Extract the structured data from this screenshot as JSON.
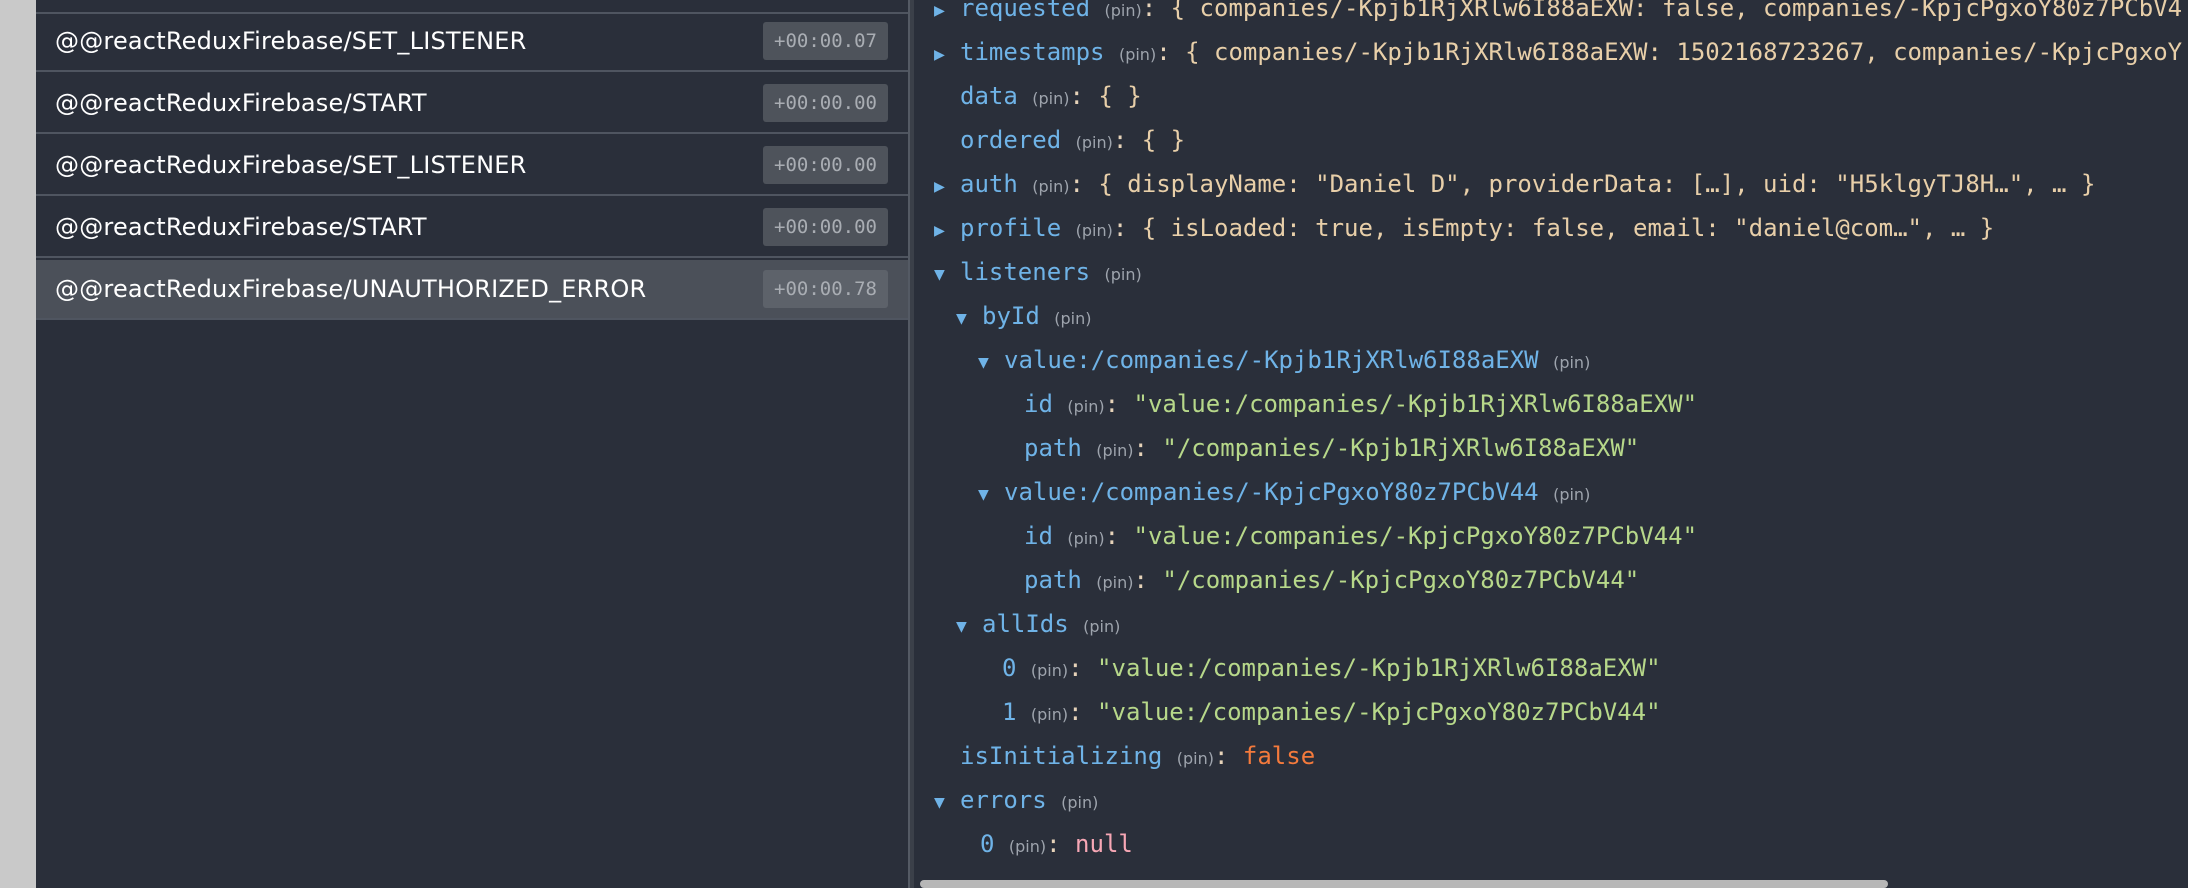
{
  "actions": [
    {
      "name": "@@reactReduxFirebase/SET_LISTENER",
      "time": "+00:00.07"
    },
    {
      "name": "@@reactReduxFirebase/START",
      "time": "+00:00.00"
    },
    {
      "name": "@@reactReduxFirebase/SET_LISTENER",
      "time": "+00:00.00"
    },
    {
      "name": "@@reactReduxFirebase/START",
      "time": "+00:00.00"
    },
    {
      "name": "@@reactReduxFirebase/UNAUTHORIZED_ERROR",
      "time": "+00:00.78",
      "selected": true
    }
  ],
  "tree": {
    "pin": "(pin)",
    "requested": {
      "key": "requested",
      "summary": "{ companies/-Kpjb1RjXRlw6I88aEXW: false, companies/-KpjcPgxoY80z7PCbV4"
    },
    "timestamps": {
      "key": "timestamps",
      "summary": "{ companies/-Kpjb1RjXRlw6I88aEXW: 1502168723267, companies/-KpjcPgxoY"
    },
    "data": {
      "key": "data",
      "summary": "{ }"
    },
    "ordered": {
      "key": "ordered",
      "summary": "{ }"
    },
    "auth": {
      "key": "auth",
      "summary": "{ displayName: \"Daniel D\", providerData: […], uid: \"H5klgyTJ8H…\", … }"
    },
    "profile": {
      "key": "profile",
      "summary": "{ isLoaded: true, isEmpty: false, email: \"daniel@com…\", … }"
    },
    "listeners": {
      "key": "listeners"
    },
    "byId": {
      "key": "byId"
    },
    "value1": {
      "key": "value:/companies/-Kpjb1RjXRlw6I88aEXW"
    },
    "value1_id": {
      "key": "id",
      "value": "\"value:/companies/-Kpjb1RjXRlw6I88aEXW\""
    },
    "value1_path": {
      "key": "path",
      "value": "\"/companies/-Kpjb1RjXRlw6I88aEXW\""
    },
    "value2": {
      "key": "value:/companies/-KpjcPgxoY80z7PCbV44"
    },
    "value2_id": {
      "key": "id",
      "value": "\"value:/companies/-KpjcPgxoY80z7PCbV44\""
    },
    "value2_path": {
      "key": "path",
      "value": "\"/companies/-KpjcPgxoY80z7PCbV44\""
    },
    "allIds": {
      "key": "allIds"
    },
    "allIds_0": {
      "key": "0",
      "value": "\"value:/companies/-Kpjb1RjXRlw6I88aEXW\""
    },
    "allIds_1": {
      "key": "1",
      "value": "\"value:/companies/-KpjcPgxoY80z7PCbV44\""
    },
    "isInitializing": {
      "key": "isInitializing",
      "value": "false"
    },
    "errors": {
      "key": "errors"
    },
    "errors_0": {
      "key": "0",
      "value": "null"
    }
  },
  "icons": {
    "expanded": "▼",
    "collapsed": "▶"
  },
  "colors": {
    "key": "#6fb3e7",
    "string": "#b7d88a",
    "bool": "#f47a3c",
    "null": "#f7a7b5",
    "background": "#2a2f3a"
  }
}
